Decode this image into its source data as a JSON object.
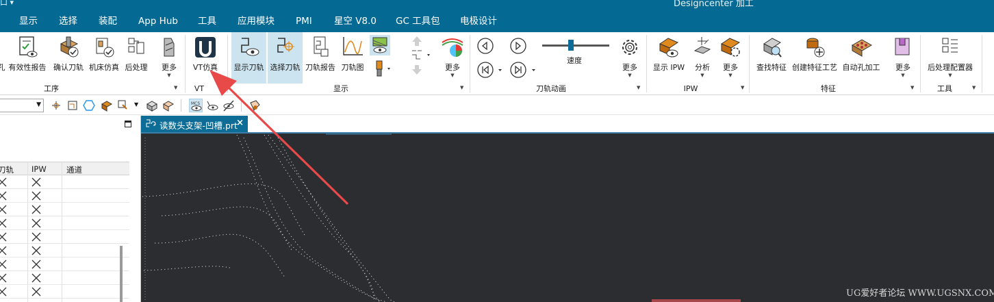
{
  "window": {
    "title_partial": "Designcenter 加工",
    "workspace_partial": "口 ▾"
  },
  "menu": [
    {
      "id": "display",
      "label": "显示"
    },
    {
      "id": "select",
      "label": "选择"
    },
    {
      "id": "assembly",
      "label": "装配"
    },
    {
      "id": "apphub",
      "label": "App Hub"
    },
    {
      "id": "tools",
      "label": "工具"
    },
    {
      "id": "appmodule",
      "label": "应用模块"
    },
    {
      "id": "pmi",
      "label": "PMI"
    },
    {
      "id": "xingkong",
      "label": "星空 V8.0"
    },
    {
      "id": "gctoolkit",
      "label": "GC 工具包"
    },
    {
      "id": "electrode",
      "label": "电极设计"
    }
  ],
  "ribbon": {
    "buttons": {
      "cut_partial": "孔",
      "validity_report": "有效性报告",
      "confirm_toolpath": "确认刀轨",
      "machine_sim": "机床仿真",
      "postprocess": "后处理",
      "more1": "更多",
      "vt_sim": "VT仿真",
      "show_toolpath": "显示刀轨",
      "select_toolpath": "选择刀轨",
      "toolpath_report": "刀轨报告",
      "toolpath_graph": "刀轨图",
      "more2": "更多",
      "speed": "速度",
      "more3": "更多",
      "show_ipw": "显示 IPW",
      "analysis": "分析",
      "more4": "更多",
      "find_feature": "查找特征",
      "create_feature_process": "创建特征工艺",
      "auto_hole": "自动孔加工",
      "more5": "更多",
      "post_configurator": "后处理配置器"
    },
    "groups": {
      "operation": "工序",
      "vt": "VT",
      "display": "显示",
      "toolpath_animation": "刀轨动画",
      "ipw": "IPW",
      "feature": "特征",
      "tools": "工具"
    }
  },
  "navigator": {
    "columns": [
      "刀轨",
      "IPW",
      "通道"
    ],
    "rows": 9
  },
  "tab": {
    "filename": "读数头支架-凹槽.prt",
    "close": "×"
  },
  "watermark": "UG爱好者论坛 WWW.UGSNX.COM",
  "colors": {
    "menubar": "#056a93",
    "tab": "#0d6d96",
    "viewport": "#2b2d31",
    "arrow": "#e84a4a",
    "selected": "#cce4f0"
  },
  "icons": [
    "vt-logo-icon",
    "show-toolpath-icon",
    "select-toolpath-icon",
    "play-icon",
    "rewind-icon",
    "gear-icon",
    "close-icon"
  ]
}
